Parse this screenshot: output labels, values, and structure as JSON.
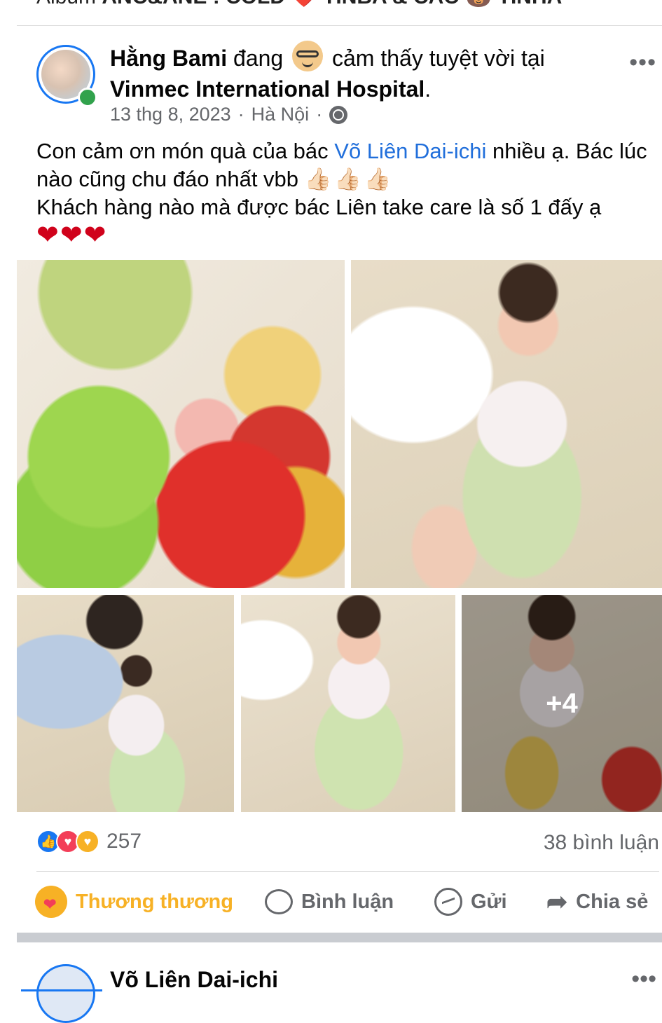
{
  "top_album": {
    "prefix": "Album ",
    "text": "ANC&ANE : COLD ❤️ TINBA & CAO 🐻 TINHA"
  },
  "post": {
    "author": "Hằng Bami",
    "feeling_prefix": "đang",
    "feeling_text": "cảm thấy tuyệt vời tại",
    "location": "Vinmec International Hospital",
    "location_suffix": ".",
    "date": "13 thg 8, 2023",
    "separator": "·",
    "city": "Hà Nội",
    "caption_part1": "Con cảm ơn món quà của bác ",
    "caption_link": "Võ Liên Dai-ichi",
    "caption_part2": " nhiều ạ. Bác lúc nào cũng chu đáo nhất vbb ",
    "thumbs": "👍🏻👍🏻👍🏻",
    "caption_line3": "Khách hàng nào mà được bác Liên take care là số 1 đấy ạ",
    "hearts": "❤❤❤",
    "more_photos": "+4"
  },
  "stats": {
    "reaction_count": "257",
    "comments": "38 bình luận"
  },
  "actions": {
    "react": "Thương thương",
    "comment": "Bình luận",
    "send": "Gửi",
    "share": "Chia sẻ"
  },
  "next_post": {
    "author": "Võ Liên Dai-ichi"
  },
  "colors": {
    "brand": "#1877f2",
    "link": "#216fdb",
    "care": "#f7b125",
    "muted": "#65676b"
  }
}
